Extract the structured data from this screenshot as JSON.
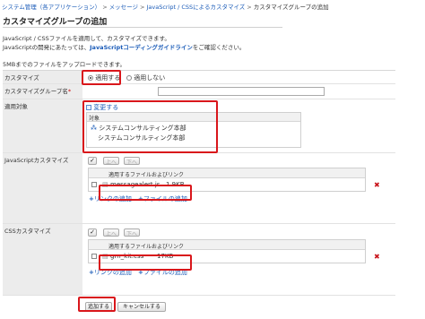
{
  "breadcrumb": {
    "items": [
      "システム管理（各アプリケーション）",
      "メッセージ",
      "JavaScript / CSSによるカスタマイズ"
    ],
    "current": "カスタマイズグループの追加"
  },
  "page": {
    "title": "カスタマイズグループの追加",
    "intro_line1": "JavaScript / CSSファイルを適用して、カスタマイズできます。",
    "intro_line2_prefix": "JavaScriptの開発にあたっては、",
    "intro_line2_link": "JavaScriptコーディングガイドライン",
    "intro_line2_suffix": "をご確認ください。",
    "upload_note": "5MBまでのファイルをアップロードできます。"
  },
  "form": {
    "customize": {
      "label": "カスタマイズ",
      "options": [
        {
          "label": "適用する",
          "selected": true
        },
        {
          "label": "適用しない",
          "selected": false
        }
      ]
    },
    "group_name": {
      "label": "カスタマイズグループ名",
      "required_mark": "*",
      "value": ""
    },
    "target": {
      "label": "適用対象",
      "change_label": "変更する",
      "header": "対象",
      "items": [
        "システムコンサルティング本部",
        "システムコンサルティング本部"
      ]
    },
    "js": {
      "label": "JavaScriptカスタマイズ",
      "up_label": "上へ",
      "down_label": "下へ",
      "header": "適用するファイルおよびリンク",
      "file_name": "messagealert.js",
      "file_size": "1.9KB",
      "add_link": "リンクの追加",
      "add_file": "ファイルの追加"
    },
    "css": {
      "label": "CSSカスタマイズ",
      "up_label": "上へ",
      "down_label": "下へ",
      "header": "適用するファイルおよびリンク",
      "file_name": "grn_kit.css",
      "file_size": "17KB",
      "add_link": "リンクの追加",
      "add_file": "ファイルの追加"
    }
  },
  "actions": {
    "submit_label": "追加する",
    "cancel_label": "キャンセルする"
  },
  "colors": {
    "highlight": "#d9161b",
    "link": "#1a5bb8",
    "delete": "#c8141b"
  }
}
